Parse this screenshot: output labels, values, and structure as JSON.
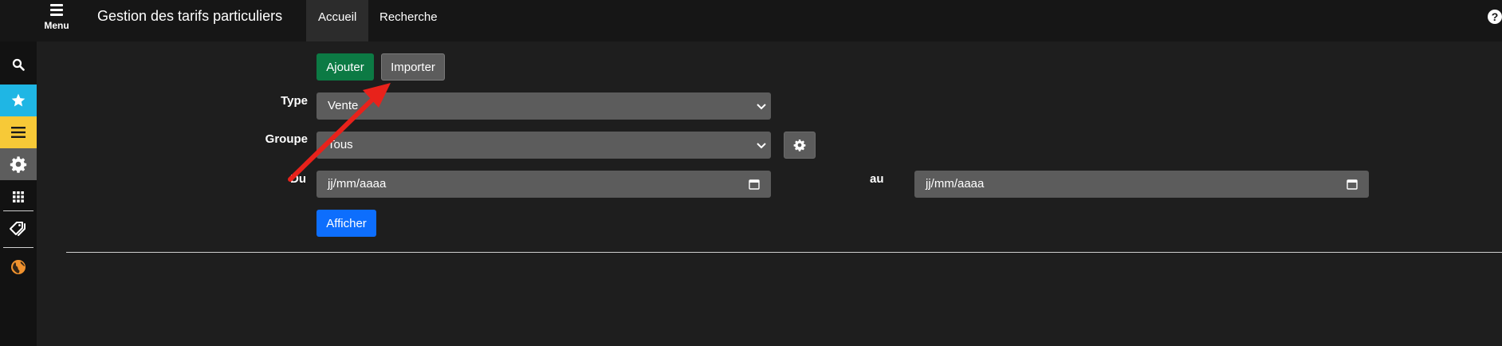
{
  "header": {
    "menu_label": "Menu",
    "title": "Gestion des tarifs particuliers",
    "tabs": [
      {
        "label": "Accueil",
        "active": true
      },
      {
        "label": "Recherche",
        "active": false
      }
    ],
    "help_glyph": "?"
  },
  "sidebar": {
    "items": [
      {
        "icon": "search-icon"
      },
      {
        "icon": "star-icon",
        "color": "#1fb6e4"
      },
      {
        "icon": "list-icon",
        "color": "#f7c937"
      },
      {
        "icon": "gear-icon",
        "color": "#5d5d5d"
      },
      {
        "icon": "grid-icon"
      },
      {
        "icon": "tags-icon"
      },
      {
        "icon": "globe-icon",
        "color": "#f0922e"
      }
    ]
  },
  "toolbar": {
    "add_label": "Ajouter",
    "import_label": "Importer"
  },
  "form": {
    "type_label": "Type",
    "type_value": "Vente",
    "group_label": "Groupe",
    "group_value": "Tous",
    "from_label": "Du",
    "from_placeholder": "jj/mm/aaaa",
    "to_label": "au",
    "to_placeholder": "jj/mm/aaaa",
    "submit_label": "Afficher"
  },
  "colors": {
    "background": "#1e1e1e",
    "topbar": "#161616",
    "add_button": "#0c7a44",
    "submit_button": "#0d6efd",
    "field": "#5c5c5c",
    "annotation_arrow": "#e8221b"
  }
}
